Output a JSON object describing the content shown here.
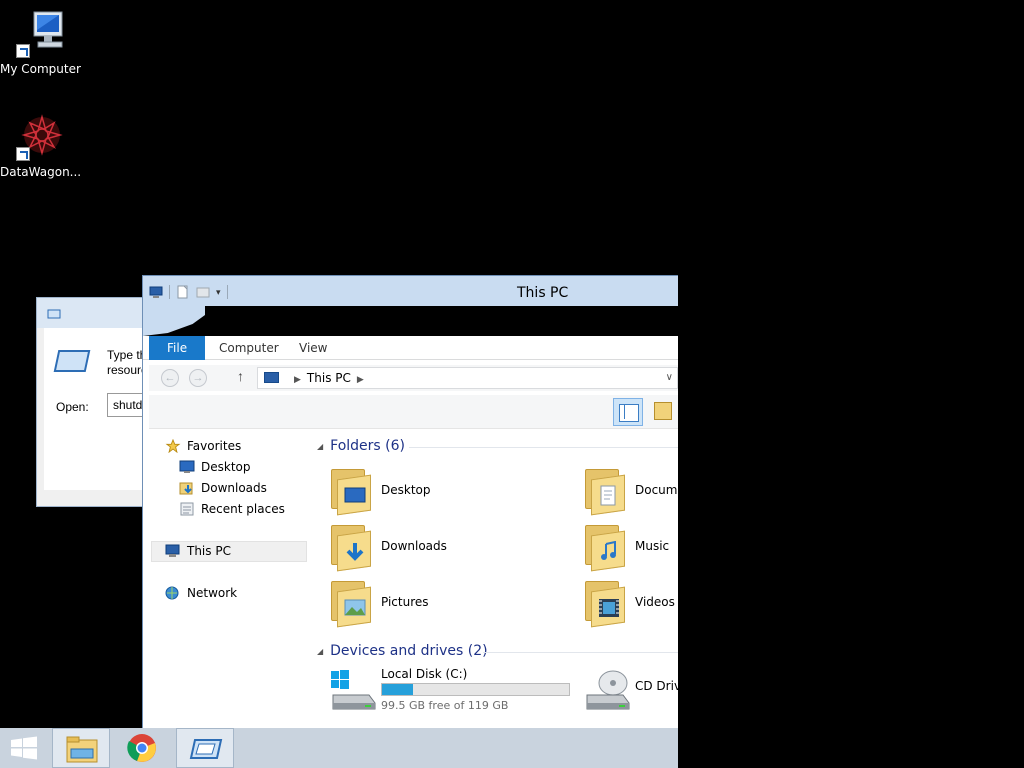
{
  "desktop": {
    "icons": [
      {
        "label": "My Computer",
        "icon": "computer-icon"
      },
      {
        "label": "DataWagon...",
        "icon": "datawagon-icon"
      }
    ]
  },
  "run_dialog": {
    "description_line1": "Type th",
    "description_line2": "resourc",
    "open_label": "Open:",
    "open_value": "shutd"
  },
  "explorer": {
    "title": "This PC",
    "ribbon_tabs": [
      "File",
      "Computer",
      "View"
    ],
    "address": {
      "location": "This PC"
    },
    "nav": {
      "favorites": "Favorites",
      "desktop": "Desktop",
      "downloads": "Downloads",
      "recent": "Recent places",
      "this_pc": "This PC",
      "network": "Network"
    },
    "folders_header": "Folders (6)",
    "folders": [
      {
        "name": "Desktop",
        "icon": "desktop-folder-icon"
      },
      {
        "name": "Docume",
        "icon": "documents-folder-icon"
      },
      {
        "name": "Downloads",
        "icon": "downloads-folder-icon"
      },
      {
        "name": "Music",
        "icon": "music-folder-icon"
      },
      {
        "name": "Pictures",
        "icon": "pictures-folder-icon"
      },
      {
        "name": "Videos",
        "icon": "videos-folder-icon"
      }
    ],
    "devices_header": "Devices and drives (2)",
    "drives": [
      {
        "name": "Local Disk (C:)",
        "free": "99.5 GB free of 119 GB",
        "used_fraction": 0.164
      },
      {
        "name": "CD Drive",
        "free": "",
        "used_fraction": null
      }
    ]
  },
  "taskbar": {
    "items": [
      "start-icon",
      "file-explorer-icon",
      "chrome-icon",
      "run-icon"
    ]
  }
}
